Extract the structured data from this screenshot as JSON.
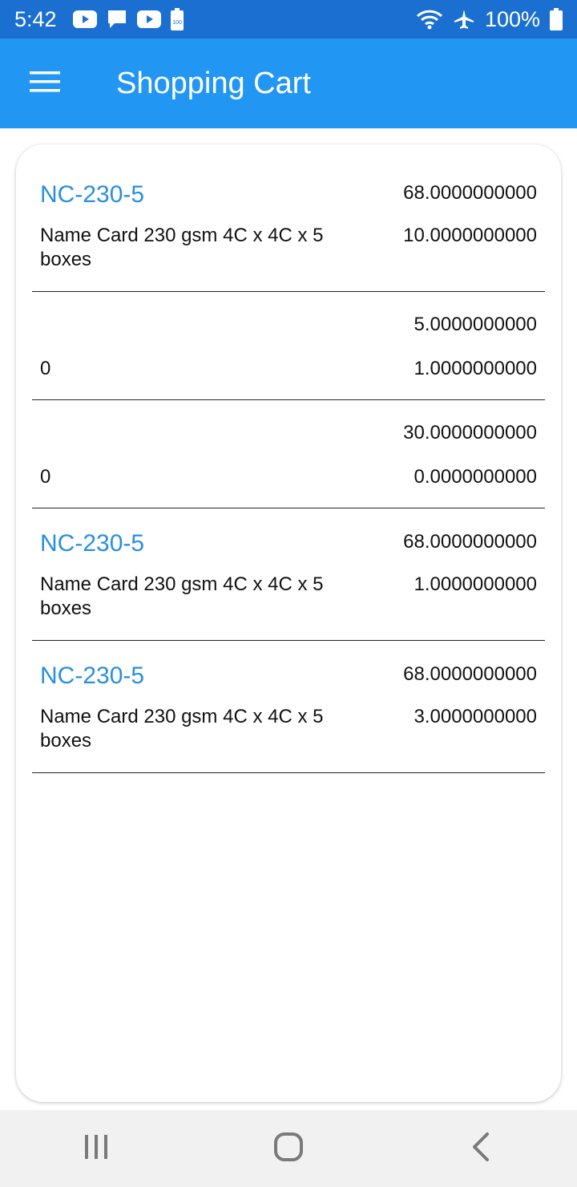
{
  "status_bar": {
    "time": "5:42",
    "battery_percent": "100%",
    "notification_icons": [
      "youtube-icon",
      "message-icon",
      "youtube-icon",
      "battery-saver-icon"
    ],
    "system_icons": [
      "wifi-icon",
      "airplane-icon",
      "battery-icon"
    ],
    "battery_saver_label": "100"
  },
  "app_bar": {
    "title": "Shopping Cart",
    "menu_icon": "hamburger-menu-icon"
  },
  "cart": {
    "items": [
      {
        "code": "NC-230-5",
        "description": "Name Card 230 gsm 4C x 4C x 5 boxes",
        "value1": "68.0000000000",
        "value2": "10.0000000000"
      },
      {
        "code": "",
        "description": "0",
        "value1": "5.0000000000",
        "value2": "1.0000000000"
      },
      {
        "code": "",
        "description": "0",
        "value1": "30.0000000000",
        "value2": "0.0000000000"
      },
      {
        "code": "NC-230-5",
        "description": "Name Card 230 gsm 4C x 4C x 5 boxes",
        "value1": "68.0000000000",
        "value2": "1.0000000000"
      },
      {
        "code": "NC-230-5",
        "description": "Name Card 230 gsm 4C x 4C x 5 boxes",
        "value1": "68.0000000000",
        "value2": "3.0000000000"
      }
    ]
  },
  "nav_bar": {
    "icons": [
      "recent-apps-icon",
      "home-icon",
      "back-icon"
    ]
  },
  "colors": {
    "status_bar": "#1a6fd0",
    "app_bar": "#2196f3",
    "code_text": "#2a8fde",
    "nav_bar": "#f1f1f1"
  }
}
